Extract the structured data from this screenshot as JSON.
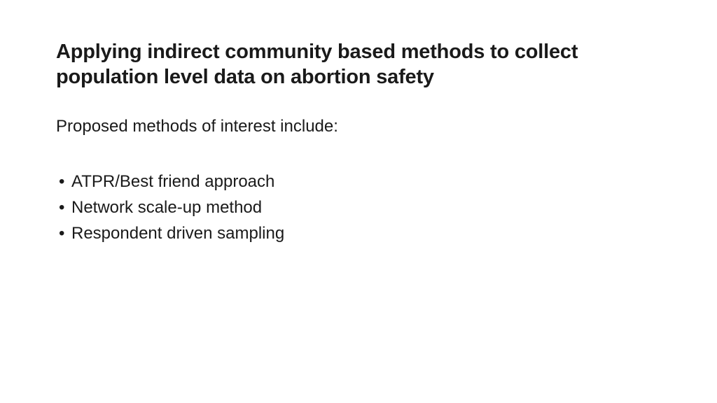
{
  "title": "Applying indirect community based methods to collect population level data on abortion safety",
  "intro": "Proposed methods of interest include:",
  "bullets": [
    "ATPR/Best friend approach",
    "Network scale-up method",
    "Respondent driven sampling"
  ]
}
